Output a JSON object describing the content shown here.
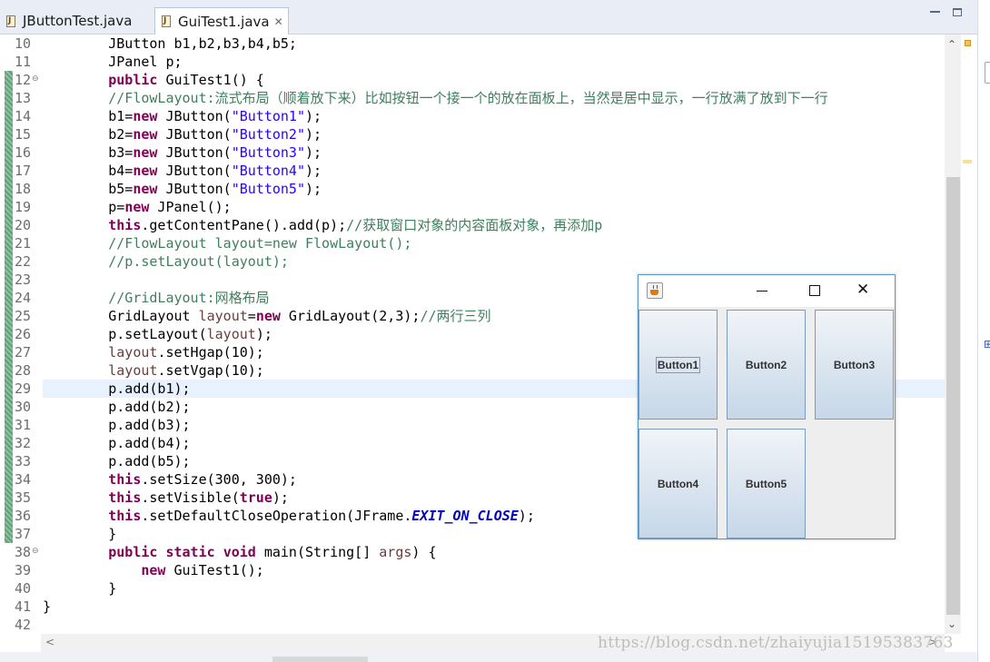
{
  "tabs": [
    {
      "label": "JButtonTest.java",
      "icon": "java-file-icon",
      "active": false
    },
    {
      "label": "GuiTest1.java",
      "icon": "java-file-icon",
      "active": true,
      "close": "✕"
    }
  ],
  "editor": {
    "current_line": 29,
    "lines": [
      {
        "n": "10",
        "code": "        JButton b1,b2,b3,b4,b5;"
      },
      {
        "n": "11",
        "code": "        JPanel p;"
      },
      {
        "n": "12",
        "code": "        public GuiTest1() {",
        "fold": "⊖"
      },
      {
        "n": "13",
        "code": "        //FlowLayout:流式布局（顺着放下来）比如按钮一个接一个的放在面板上，当然是居中显示，一行放满了放到下一行"
      },
      {
        "n": "14",
        "code": "        b1=new JButton(\"Button1\");"
      },
      {
        "n": "15",
        "code": "        b2=new JButton(\"Button2\");"
      },
      {
        "n": "16",
        "code": "        b3=new JButton(\"Button3\");"
      },
      {
        "n": "17",
        "code": "        b4=new JButton(\"Button4\");"
      },
      {
        "n": "18",
        "code": "        b5=new JButton(\"Button5\");"
      },
      {
        "n": "19",
        "code": "        p=new JPanel();"
      },
      {
        "n": "20",
        "code": "        this.getContentPane().add(p);//获取窗口对象的内容面板对象，再添加p"
      },
      {
        "n": "21",
        "code": "        //FlowLayout layout=new FlowLayout();"
      },
      {
        "n": "22",
        "code": "        //p.setLayout(layout);"
      },
      {
        "n": "23",
        "code": ""
      },
      {
        "n": "24",
        "code": "        //GridLayout:网格布局"
      },
      {
        "n": "25",
        "code": "        GridLayout layout=new GridLayout(2,3);//两行三列"
      },
      {
        "n": "26",
        "code": "        p.setLayout(layout);"
      },
      {
        "n": "27",
        "code": "        layout.setHgap(10);"
      },
      {
        "n": "28",
        "code": "        layout.setVgap(10);"
      },
      {
        "n": "29",
        "code": "        p.add(b1);"
      },
      {
        "n": "30",
        "code": "        p.add(b2);"
      },
      {
        "n": "31",
        "code": "        p.add(b3);"
      },
      {
        "n": "32",
        "code": "        p.add(b4);"
      },
      {
        "n": "33",
        "code": "        p.add(b5);"
      },
      {
        "n": "34",
        "code": "        this.setSize(300, 300);"
      },
      {
        "n": "35",
        "code": "        this.setVisible(true);"
      },
      {
        "n": "36",
        "code": "        this.setDefaultCloseOperation(JFrame.EXIT_ON_CLOSE);"
      },
      {
        "n": "37",
        "code": "        }"
      },
      {
        "n": "38",
        "code": "        public static void main(String[] args) {",
        "fold": "⊖"
      },
      {
        "n": "39",
        "code": "            new GuiTest1();"
      },
      {
        "n": "40",
        "code": "        }"
      },
      {
        "n": "41",
        "code": "}"
      },
      {
        "n": "42",
        "code": ""
      }
    ]
  },
  "swing_window": {
    "icon": "java-cup-icon",
    "controls": {
      "minimize": "minimize-icon",
      "maximize": "maximize-icon",
      "close": "✕"
    },
    "buttons": [
      {
        "label": "Button1",
        "focused": true
      },
      {
        "label": "Button2"
      },
      {
        "label": "Button3"
      },
      {
        "label": "Button4"
      },
      {
        "label": "Button5"
      }
    ]
  },
  "scrollbars": {
    "up": "⌃",
    "down": "⌄",
    "left": "<",
    "right": ">"
  },
  "watermark": "https://blog.csdn.net/zhaiyujia15195383763",
  "colors": {
    "keyword": "#7f0055",
    "string": "#2a00ff",
    "comment": "#3f7f5f",
    "static_field": "#0000c0",
    "current_line": "#e8f2fe",
    "window_border": "#5c93c8"
  }
}
